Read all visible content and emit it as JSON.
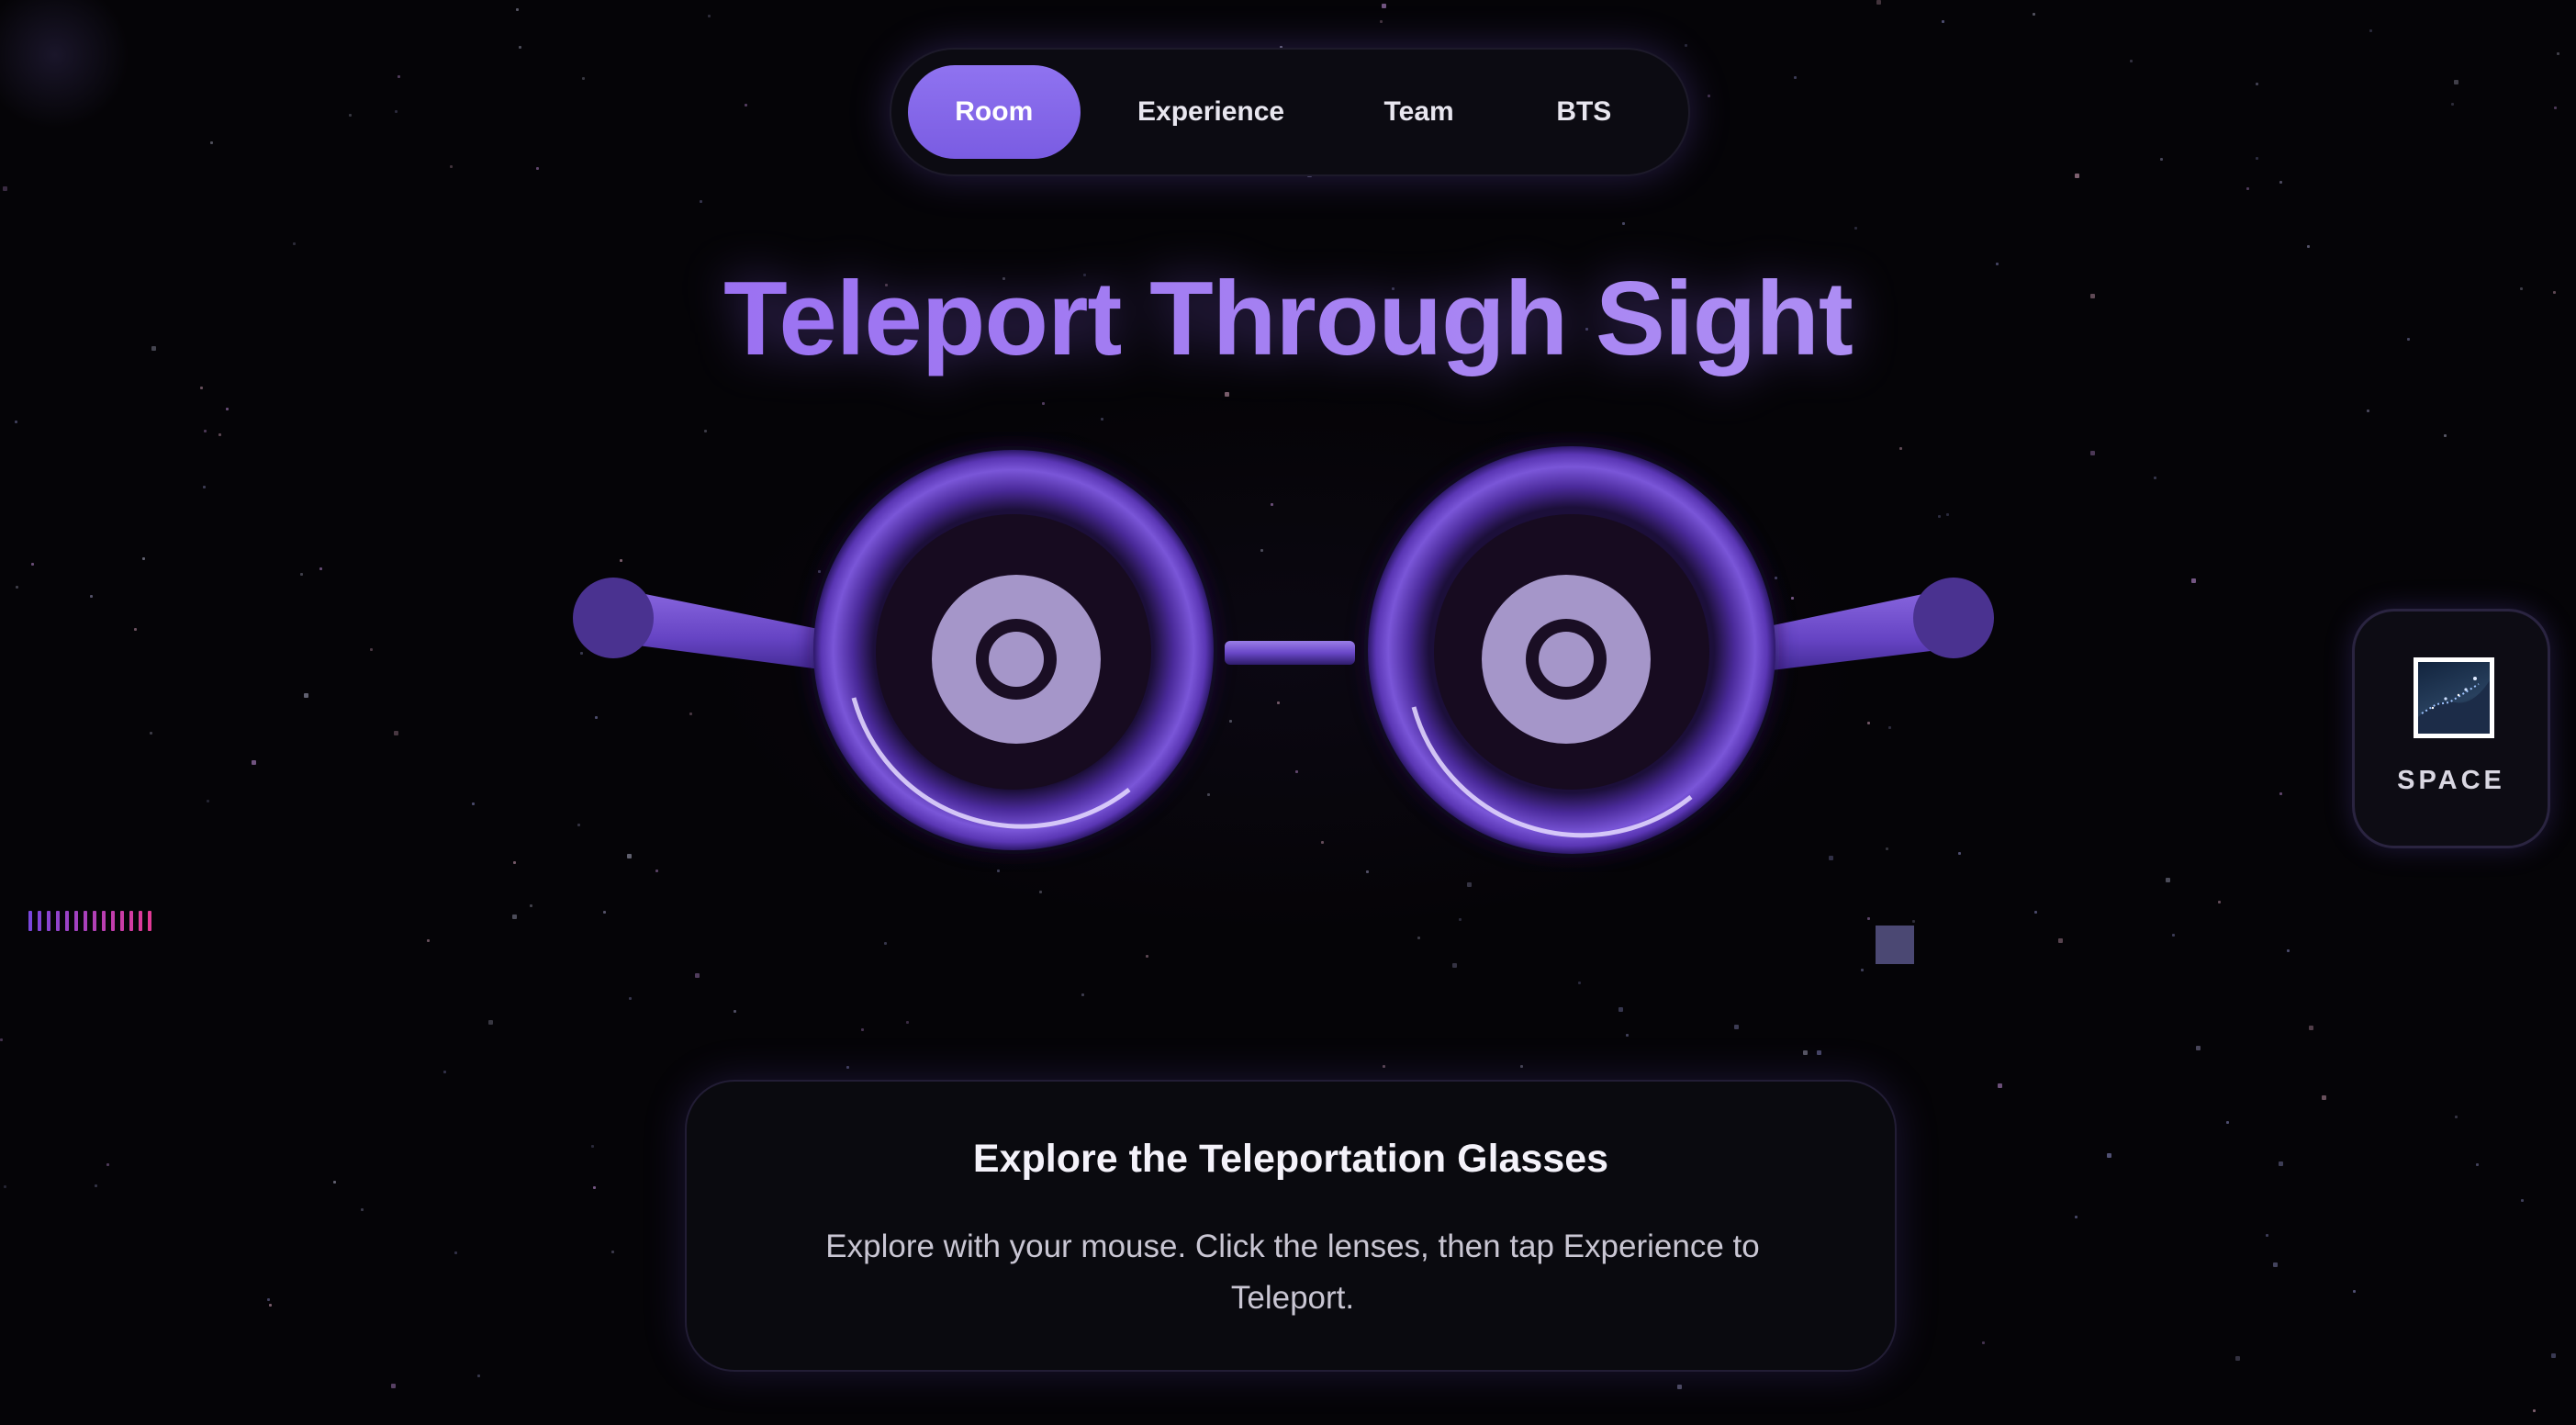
{
  "nav": {
    "items": [
      {
        "label": "Room",
        "active": true
      },
      {
        "label": "Experience",
        "active": false
      },
      {
        "label": "Team",
        "active": false
      },
      {
        "label": "BTS",
        "active": false
      }
    ]
  },
  "hero": {
    "title": "Teleport Through Sight"
  },
  "space_button": {
    "label": "SPACE",
    "icon": "space-image-icon"
  },
  "info_card": {
    "title": "Explore the Teleportation Glasses",
    "text": "Explore with your mouse. Click the lenses, then tap Experience to Teleport."
  },
  "colors": {
    "accent": "#8a66ee",
    "frame": "#6a44c8",
    "lens": "#a596c9",
    "background": "#050407"
  }
}
